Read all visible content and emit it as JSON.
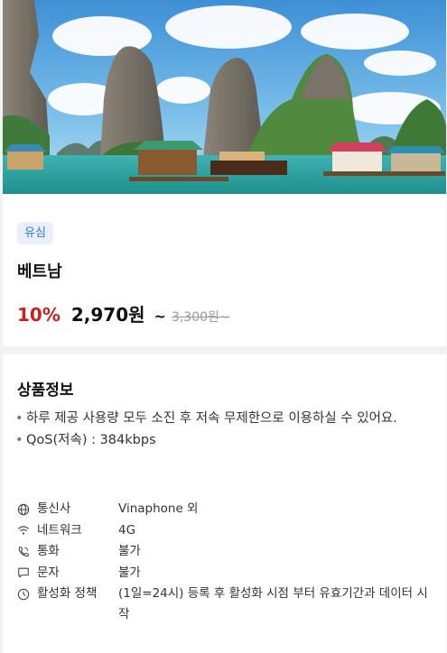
{
  "hero": {
    "alt_scene": "halong-bay-limestone-karsts"
  },
  "product": {
    "badge": "유심",
    "title": "베트남",
    "discount": "10%",
    "price": "2,970원",
    "tilde": "~",
    "original_price": "3,300원",
    "original_suffix": "~"
  },
  "info": {
    "title": "상품정보",
    "bullets": [
      "하루 제공 사용량 모두 소진 후 저속 무제한으로 이용하실 수 있어요.",
      "QoS(저속) : 384kbps"
    ],
    "specs": [
      {
        "icon": "globe-icon",
        "label": "통신사",
        "value": "Vinaphone 외"
      },
      {
        "icon": "wifi-icon",
        "label": "네트워크",
        "value": "4G"
      },
      {
        "icon": "phone-icon",
        "label": "통화",
        "value": "불가"
      },
      {
        "icon": "message-icon",
        "label": "문자",
        "value": "불가"
      },
      {
        "icon": "clock-icon",
        "label": "활성화 정책",
        "value": "(1일=24시) 등록 후 활성화 시점 부터 유효기간과 데이터 시작"
      }
    ]
  },
  "colors": {
    "discount": "#cc1f1f",
    "badge_bg": "#e8f0fb",
    "badge_text": "#2f7ad6"
  }
}
